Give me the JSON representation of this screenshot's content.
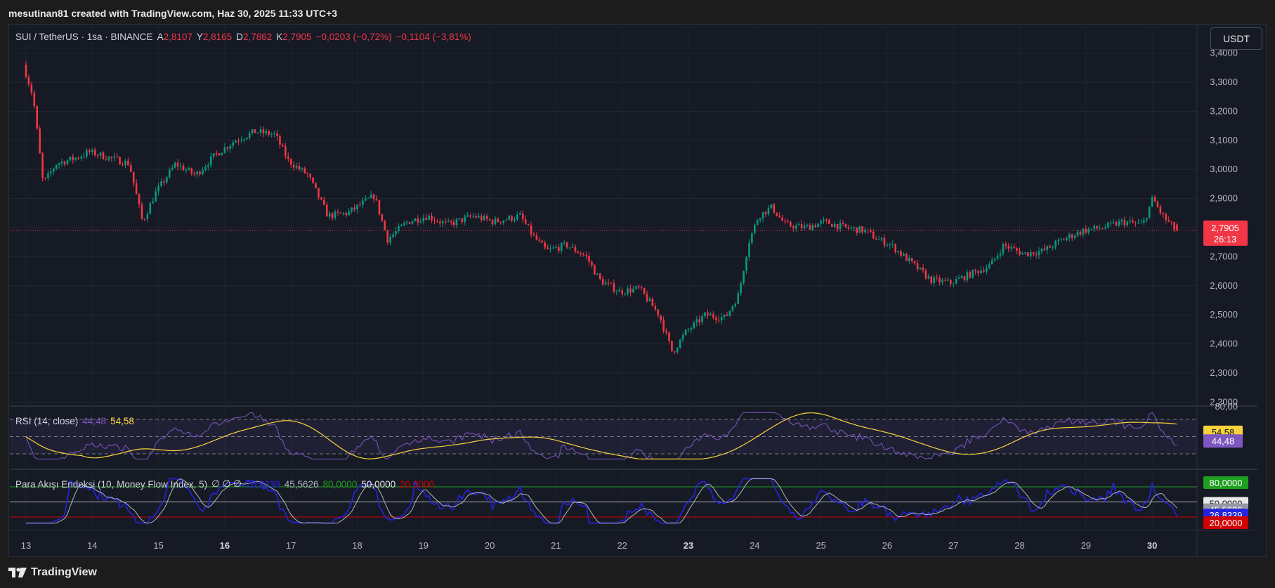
{
  "caption": "mesutinan81 created with TradingView.com, Haz 30, 2025 11:33 UTC+3",
  "currency_button": "USDT",
  "footer_logo_text": "TradingView",
  "legend": {
    "symbol": "SUI / TetherUS · 1sa · BINANCE",
    "o_label": "A",
    "o_value": "2,8107",
    "h_label": "Y",
    "h_value": "2,8165",
    "l_label": "D",
    "l_value": "2,7862",
    "c_label": "K",
    "c_value": "2,7905",
    "change": "−0,0203 (−0,72%)",
    "change2": "−0,1104 (−3,81%)"
  },
  "rsi_legend": {
    "name": "RSI (14, close)",
    "rsi": "44,48",
    "ma": "54,58"
  },
  "mfi_legend": {
    "name": "Para Akışı Endeksi (10, Money Flow Index, 5)",
    "flags": "∅  ∅  ∅",
    "mfi": "26,8339",
    "ma": "45,5626",
    "upper": "80,0000",
    "mid": "50,0000",
    "lower": "20,0000"
  },
  "price_axis": {
    "ticks": [
      "3,4000",
      "3,3000",
      "3,2000",
      "3,1000",
      "3,0000",
      "2,9000",
      "2,8000",
      "2,7000",
      "2,6000",
      "2,5000",
      "2,4000",
      "2,3000",
      "2,2000"
    ],
    "current_price": "2,7905",
    "countdown": "26:13"
  },
  "rsi_axis": {
    "top": "80,00",
    "rsi_badge": "44,48",
    "ma_badge": "54,58"
  },
  "mfi_axis": {
    "top": "80,0000",
    "mid": "50,0000",
    "ma": "45,5626",
    "mfi": "26,8339",
    "low": "20,0000"
  },
  "x_axis": {
    "labels": [
      "13",
      "14",
      "15",
      "16",
      "17",
      "18",
      "19",
      "20",
      "21",
      "22",
      "23",
      "24",
      "25",
      "26",
      "27",
      "28",
      "29",
      "30"
    ],
    "bold": [
      "16",
      "23",
      "30"
    ]
  },
  "colors": {
    "up": "#089981",
    "down": "#f23645",
    "rsi": "#7e57c2",
    "rsi_ma": "#f7d33b",
    "mfi": "#2424e0",
    "mfi_ma": "#b2b5be"
  },
  "chart_data": {
    "type": "candlestick",
    "title": "SUI / TetherUS · 1sa · BINANCE",
    "x_range": [
      "13",
      "30"
    ],
    "ylim": [
      2.2,
      3.4
    ],
    "anchors": [
      [
        13.0,
        3.36
      ],
      [
        13.15,
        3.25
      ],
      [
        13.3,
        2.95
      ],
      [
        13.5,
        3.02
      ],
      [
        13.8,
        3.04
      ],
      [
        14.0,
        3.06
      ],
      [
        14.3,
        3.04
      ],
      [
        14.6,
        3.02
      ],
      [
        14.8,
        2.82
      ],
      [
        15.0,
        2.92
      ],
      [
        15.3,
        3.02
      ],
      [
        15.6,
        2.98
      ],
      [
        15.9,
        3.05
      ],
      [
        16.2,
        3.1
      ],
      [
        16.5,
        3.13
      ],
      [
        16.8,
        3.12
      ],
      [
        17.0,
        3.03
      ],
      [
        17.3,
        2.98
      ],
      [
        17.6,
        2.84
      ],
      [
        17.9,
        2.85
      ],
      [
        18.3,
        2.91
      ],
      [
        18.5,
        2.76
      ],
      [
        18.8,
        2.82
      ],
      [
        19.1,
        2.84
      ],
      [
        19.4,
        2.81
      ],
      [
        19.8,
        2.84
      ],
      [
        20.1,
        2.82
      ],
      [
        20.5,
        2.84
      ],
      [
        20.7,
        2.77
      ],
      [
        20.9,
        2.72
      ],
      [
        21.2,
        2.74
      ],
      [
        21.5,
        2.7
      ],
      [
        21.7,
        2.62
      ],
      [
        22.0,
        2.58
      ],
      [
        22.3,
        2.59
      ],
      [
        22.6,
        2.5
      ],
      [
        22.8,
        2.37
      ],
      [
        23.0,
        2.44
      ],
      [
        23.3,
        2.5
      ],
      [
        23.6,
        2.49
      ],
      [
        23.8,
        2.57
      ],
      [
        23.95,
        2.75
      ],
      [
        24.1,
        2.84
      ],
      [
        24.3,
        2.87
      ],
      [
        24.5,
        2.81
      ],
      [
        24.8,
        2.8
      ],
      [
        25.1,
        2.82
      ],
      [
        25.4,
        2.8
      ],
      [
        25.7,
        2.79
      ],
      [
        25.9,
        2.76
      ],
      [
        26.1,
        2.74
      ],
      [
        26.4,
        2.68
      ],
      [
        26.7,
        2.62
      ],
      [
        27.0,
        2.61
      ],
      [
        27.3,
        2.64
      ],
      [
        27.6,
        2.67
      ],
      [
        27.8,
        2.74
      ],
      [
        28.1,
        2.71
      ],
      [
        28.4,
        2.72
      ],
      [
        28.7,
        2.76
      ],
      [
        29.0,
        2.79
      ],
      [
        29.3,
        2.8
      ],
      [
        29.6,
        2.82
      ],
      [
        29.9,
        2.81
      ],
      [
        30.05,
        2.9
      ],
      [
        30.2,
        2.84
      ],
      [
        30.4,
        2.79
      ]
    ],
    "rsi_ylim": [
      20,
      80
    ],
    "rsi_levels": [
      70,
      50,
      30
    ],
    "mfi_ylim": [
      0,
      100
    ],
    "mfi_levels": [
      80,
      50,
      20
    ]
  }
}
